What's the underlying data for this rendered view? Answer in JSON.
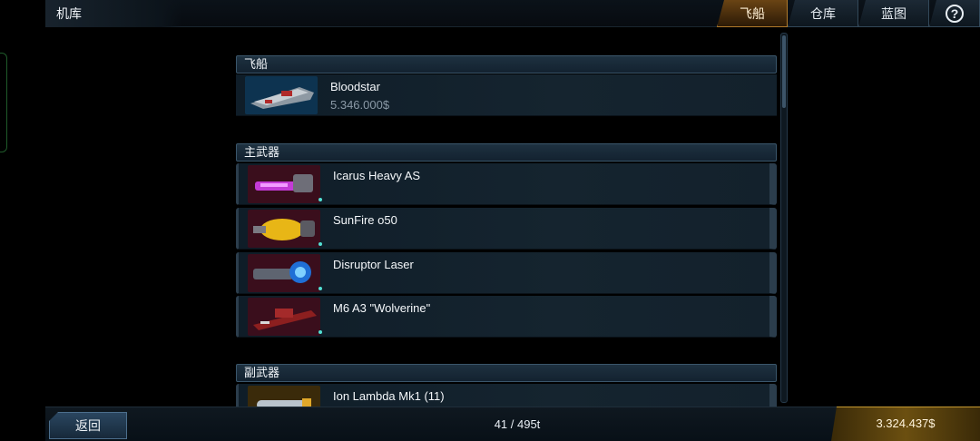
{
  "header": {
    "title": "机库"
  },
  "tabs": [
    {
      "label": "飞船",
      "active": true
    },
    {
      "label": "仓库",
      "active": false
    },
    {
      "label": "蓝图",
      "active": false
    },
    {
      "label": "?",
      "icon": "help-icon"
    }
  ],
  "sections": {
    "ship": {
      "title": "飞船",
      "item": {
        "name": "Bloodstar",
        "price": "5.346.000$",
        "icon": "ship-thumbnail"
      }
    },
    "primary": {
      "title": "主武器",
      "items": [
        {
          "name": "Icarus Heavy AS",
          "icon": "purple-laser-weapon"
        },
        {
          "name": "SunFire o50",
          "icon": "yellow-plasma-weapon"
        },
        {
          "name": "Disruptor Laser",
          "icon": "blue-disruptor-weapon"
        },
        {
          "name": "M6 A3 \"Wolverine\"",
          "icon": "red-gun-weapon"
        }
      ]
    },
    "secondary": {
      "title": "副武器",
      "items": [
        {
          "name": "Ion Lambda Mk1 (11)",
          "icon": "ion-missile-weapon"
        }
      ]
    }
  },
  "footer": {
    "back_label": "返回",
    "capacity": "41 / 495t",
    "money": "3.324.437$"
  },
  "colors": {
    "accent_gold": "#b07a2a",
    "panel_border": "#3a566b",
    "indicator_dot": "#53e0d4"
  }
}
